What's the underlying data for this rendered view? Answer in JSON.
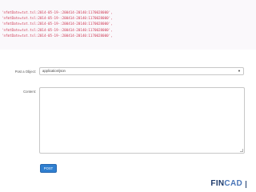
{
  "code_output": {
    "lines": [
      "'nfmtDate=txt.tsl:2014-05-19-:200414-20140:1170028000',",
      "'nfmtDate=txt.tsl:2014-05-19-:200414-20140:1170028000',",
      "'nfmtDate=txt.tsl:2014-05-19-:200414-20140:1170028000',",
      "'nfmtDate=txt.tsl:2014-05-19-:200414-20140:1170028000',",
      "'nfmtDate=txt.tsl:2014-05-19-:200414-20140:1170028000',"
    ]
  },
  "form": {
    "type_label": "Post a Object:",
    "type_selected": "application/json",
    "content_label": "Content:",
    "submit_label": "POST"
  },
  "footer": {
    "brand_main": "FIN",
    "brand_alt": "CAD"
  }
}
